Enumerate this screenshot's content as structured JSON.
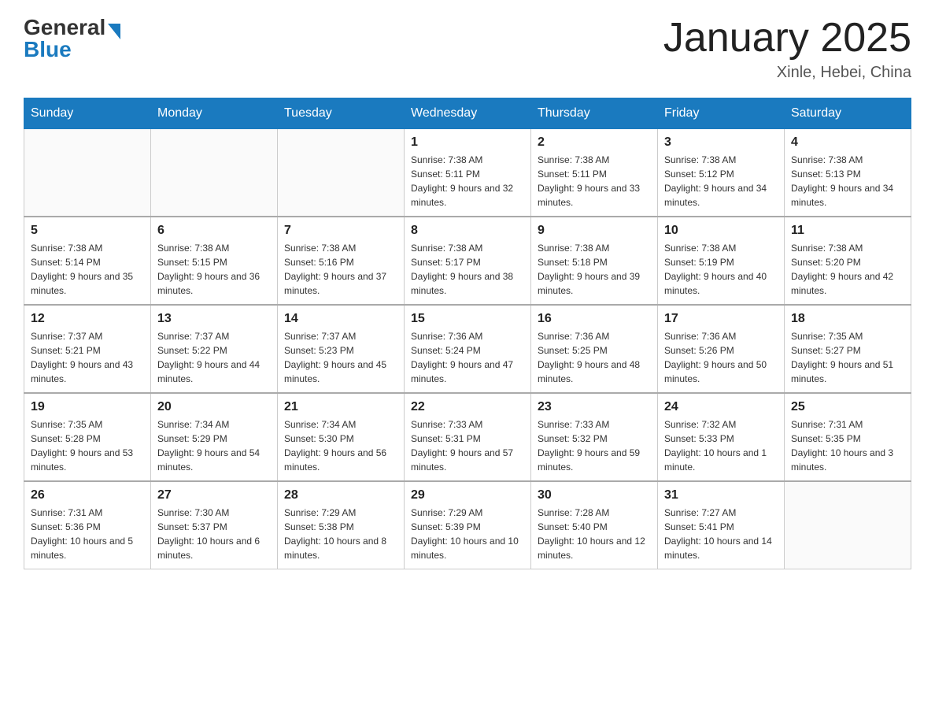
{
  "header": {
    "logo_text_black": "General",
    "logo_text_blue": "Blue",
    "month_title": "January 2025",
    "location": "Xinle, Hebei, China"
  },
  "days_of_week": [
    "Sunday",
    "Monday",
    "Tuesday",
    "Wednesday",
    "Thursday",
    "Friday",
    "Saturday"
  ],
  "weeks": [
    [
      null,
      null,
      null,
      {
        "day": "1",
        "sunrise": "Sunrise: 7:38 AM",
        "sunset": "Sunset: 5:11 PM",
        "daylight": "Daylight: 9 hours and 32 minutes."
      },
      {
        "day": "2",
        "sunrise": "Sunrise: 7:38 AM",
        "sunset": "Sunset: 5:11 PM",
        "daylight": "Daylight: 9 hours and 33 minutes."
      },
      {
        "day": "3",
        "sunrise": "Sunrise: 7:38 AM",
        "sunset": "Sunset: 5:12 PM",
        "daylight": "Daylight: 9 hours and 34 minutes."
      },
      {
        "day": "4",
        "sunrise": "Sunrise: 7:38 AM",
        "sunset": "Sunset: 5:13 PM",
        "daylight": "Daylight: 9 hours and 34 minutes."
      }
    ],
    [
      {
        "day": "5",
        "sunrise": "Sunrise: 7:38 AM",
        "sunset": "Sunset: 5:14 PM",
        "daylight": "Daylight: 9 hours and 35 minutes."
      },
      {
        "day": "6",
        "sunrise": "Sunrise: 7:38 AM",
        "sunset": "Sunset: 5:15 PM",
        "daylight": "Daylight: 9 hours and 36 minutes."
      },
      {
        "day": "7",
        "sunrise": "Sunrise: 7:38 AM",
        "sunset": "Sunset: 5:16 PM",
        "daylight": "Daylight: 9 hours and 37 minutes."
      },
      {
        "day": "8",
        "sunrise": "Sunrise: 7:38 AM",
        "sunset": "Sunset: 5:17 PM",
        "daylight": "Daylight: 9 hours and 38 minutes."
      },
      {
        "day": "9",
        "sunrise": "Sunrise: 7:38 AM",
        "sunset": "Sunset: 5:18 PM",
        "daylight": "Daylight: 9 hours and 39 minutes."
      },
      {
        "day": "10",
        "sunrise": "Sunrise: 7:38 AM",
        "sunset": "Sunset: 5:19 PM",
        "daylight": "Daylight: 9 hours and 40 minutes."
      },
      {
        "day": "11",
        "sunrise": "Sunrise: 7:38 AM",
        "sunset": "Sunset: 5:20 PM",
        "daylight": "Daylight: 9 hours and 42 minutes."
      }
    ],
    [
      {
        "day": "12",
        "sunrise": "Sunrise: 7:37 AM",
        "sunset": "Sunset: 5:21 PM",
        "daylight": "Daylight: 9 hours and 43 minutes."
      },
      {
        "day": "13",
        "sunrise": "Sunrise: 7:37 AM",
        "sunset": "Sunset: 5:22 PM",
        "daylight": "Daylight: 9 hours and 44 minutes."
      },
      {
        "day": "14",
        "sunrise": "Sunrise: 7:37 AM",
        "sunset": "Sunset: 5:23 PM",
        "daylight": "Daylight: 9 hours and 45 minutes."
      },
      {
        "day": "15",
        "sunrise": "Sunrise: 7:36 AM",
        "sunset": "Sunset: 5:24 PM",
        "daylight": "Daylight: 9 hours and 47 minutes."
      },
      {
        "day": "16",
        "sunrise": "Sunrise: 7:36 AM",
        "sunset": "Sunset: 5:25 PM",
        "daylight": "Daylight: 9 hours and 48 minutes."
      },
      {
        "day": "17",
        "sunrise": "Sunrise: 7:36 AM",
        "sunset": "Sunset: 5:26 PM",
        "daylight": "Daylight: 9 hours and 50 minutes."
      },
      {
        "day": "18",
        "sunrise": "Sunrise: 7:35 AM",
        "sunset": "Sunset: 5:27 PM",
        "daylight": "Daylight: 9 hours and 51 minutes."
      }
    ],
    [
      {
        "day": "19",
        "sunrise": "Sunrise: 7:35 AM",
        "sunset": "Sunset: 5:28 PM",
        "daylight": "Daylight: 9 hours and 53 minutes."
      },
      {
        "day": "20",
        "sunrise": "Sunrise: 7:34 AM",
        "sunset": "Sunset: 5:29 PM",
        "daylight": "Daylight: 9 hours and 54 minutes."
      },
      {
        "day": "21",
        "sunrise": "Sunrise: 7:34 AM",
        "sunset": "Sunset: 5:30 PM",
        "daylight": "Daylight: 9 hours and 56 minutes."
      },
      {
        "day": "22",
        "sunrise": "Sunrise: 7:33 AM",
        "sunset": "Sunset: 5:31 PM",
        "daylight": "Daylight: 9 hours and 57 minutes."
      },
      {
        "day": "23",
        "sunrise": "Sunrise: 7:33 AM",
        "sunset": "Sunset: 5:32 PM",
        "daylight": "Daylight: 9 hours and 59 minutes."
      },
      {
        "day": "24",
        "sunrise": "Sunrise: 7:32 AM",
        "sunset": "Sunset: 5:33 PM",
        "daylight": "Daylight: 10 hours and 1 minute."
      },
      {
        "day": "25",
        "sunrise": "Sunrise: 7:31 AM",
        "sunset": "Sunset: 5:35 PM",
        "daylight": "Daylight: 10 hours and 3 minutes."
      }
    ],
    [
      {
        "day": "26",
        "sunrise": "Sunrise: 7:31 AM",
        "sunset": "Sunset: 5:36 PM",
        "daylight": "Daylight: 10 hours and 5 minutes."
      },
      {
        "day": "27",
        "sunrise": "Sunrise: 7:30 AM",
        "sunset": "Sunset: 5:37 PM",
        "daylight": "Daylight: 10 hours and 6 minutes."
      },
      {
        "day": "28",
        "sunrise": "Sunrise: 7:29 AM",
        "sunset": "Sunset: 5:38 PM",
        "daylight": "Daylight: 10 hours and 8 minutes."
      },
      {
        "day": "29",
        "sunrise": "Sunrise: 7:29 AM",
        "sunset": "Sunset: 5:39 PM",
        "daylight": "Daylight: 10 hours and 10 minutes."
      },
      {
        "day": "30",
        "sunrise": "Sunrise: 7:28 AM",
        "sunset": "Sunset: 5:40 PM",
        "daylight": "Daylight: 10 hours and 12 minutes."
      },
      {
        "day": "31",
        "sunrise": "Sunrise: 7:27 AM",
        "sunset": "Sunset: 5:41 PM",
        "daylight": "Daylight: 10 hours and 14 minutes."
      },
      null
    ]
  ]
}
